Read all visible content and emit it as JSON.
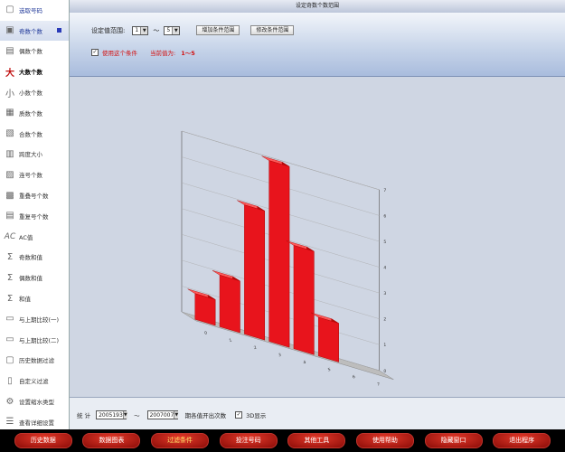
{
  "sidebar": {
    "items": [
      {
        "label": "选取号码",
        "icon": "select-icon"
      },
      {
        "label": "奇数个数",
        "icon": "odd-icon"
      },
      {
        "label": "偶数个数",
        "icon": "even-icon"
      },
      {
        "label": "大数个数",
        "icon": "big-icon"
      },
      {
        "label": "小数个数",
        "icon": "small-icon"
      },
      {
        "label": "质数个数",
        "icon": "prime-icon"
      },
      {
        "label": "合数个数",
        "icon": "composite-icon"
      },
      {
        "label": "跨度大小",
        "icon": "span-icon"
      },
      {
        "label": "连号个数",
        "icon": "consecutive-icon"
      },
      {
        "label": "重叠号个数",
        "icon": "overlap-icon"
      },
      {
        "label": "重复号个数",
        "icon": "repeat-icon"
      },
      {
        "label": "AC值",
        "icon": "ac-icon"
      },
      {
        "label": "奇数和值",
        "icon": "sigma-icon"
      },
      {
        "label": "偶数和值",
        "icon": "sigma-icon"
      },
      {
        "label": "和值",
        "icon": "sigma-icon"
      },
      {
        "label": "与上期比较(一)",
        "icon": "compare-icon"
      },
      {
        "label": "与上期比较(二)",
        "icon": "compare-icon"
      },
      {
        "label": "历史数据过滤",
        "icon": "history-icon"
      },
      {
        "label": "自定义过滤",
        "icon": "custom-icon"
      },
      {
        "label": "设置缩水类型",
        "icon": "settings-icon"
      },
      {
        "label": "查看详细设置",
        "icon": "detail-icon"
      }
    ]
  },
  "panel": {
    "title": "设定奇数个数范围",
    "range_label": "设定值范围:",
    "range_from": "1",
    "range_tilde": "～",
    "range_to": "5",
    "add_button": "增加条件范围",
    "modify_button": "修改条件范围",
    "use_condition_label": "使用这个条件",
    "use_condition_checked": "✓",
    "current_value_label": "当前值为:",
    "current_value": "1～5"
  },
  "footer": {
    "stats_label": "统 计",
    "from_period": "2005193",
    "tilde": "～",
    "to_period": "2007007",
    "desc": "期各值开出次数",
    "three_d_label": "3D显示",
    "three_d_checked": "✓"
  },
  "bottom_buttons": [
    "历史数据",
    "数据图表",
    "过滤条件",
    "投注号码",
    "其他工具",
    "使用帮助",
    "隐藏窗口",
    "退出程序"
  ],
  "chart_data": {
    "type": "bar",
    "categories": [
      "0",
      "1",
      "2",
      "3",
      "4",
      "5",
      "6",
      "7"
    ],
    "values": [
      1,
      2,
      5,
      7,
      4,
      1.5,
      0,
      0
    ],
    "ylim": [
      0,
      7
    ],
    "color": "#e8141c"
  }
}
